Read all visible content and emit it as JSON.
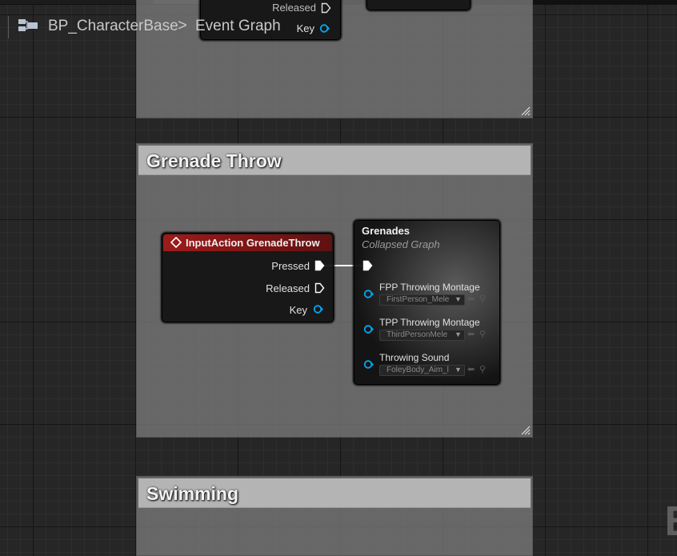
{
  "breadcrumb": {
    "blueprint": "BP_CharacterBase",
    "separator": ">",
    "graph": "Event Graph"
  },
  "top_node_partial": {
    "released_label": "Released",
    "key_label": "Key"
  },
  "comments": [
    {
      "title": "Grenade Throw"
    },
    {
      "title": "Swimming"
    }
  ],
  "input_action_node": {
    "title": "InputAction GrenadeThrow",
    "pins": {
      "pressed": "Pressed",
      "released": "Released",
      "key": "Key"
    }
  },
  "collapsed_node": {
    "title": "Grenades",
    "subtitle": "Collapsed Graph",
    "inputs": [
      {
        "label": "FPP Throwing Montage",
        "value": "FirstPerson_Mele"
      },
      {
        "label": "TPP Throwing Montage",
        "value": "ThirdPersonMele"
      },
      {
        "label": "Throwing Sound",
        "value": "FoleyBody_Aim_l"
      }
    ]
  },
  "watermark": "B",
  "colors": {
    "exec_pin": "#ffffff",
    "object_pin": "#00a8f4",
    "input_action_header": "#9e1b1b",
    "comment_header": "#b4b4b4"
  },
  "icons": [
    "blueprint-icon",
    "chevron-right-icon",
    "exec-pin-icon",
    "object-pin-icon",
    "dropdown-arrow-icon",
    "use-asset-arrow-icon",
    "browse-search-icon",
    "resize-grip-icon",
    "input-action-icon"
  ]
}
